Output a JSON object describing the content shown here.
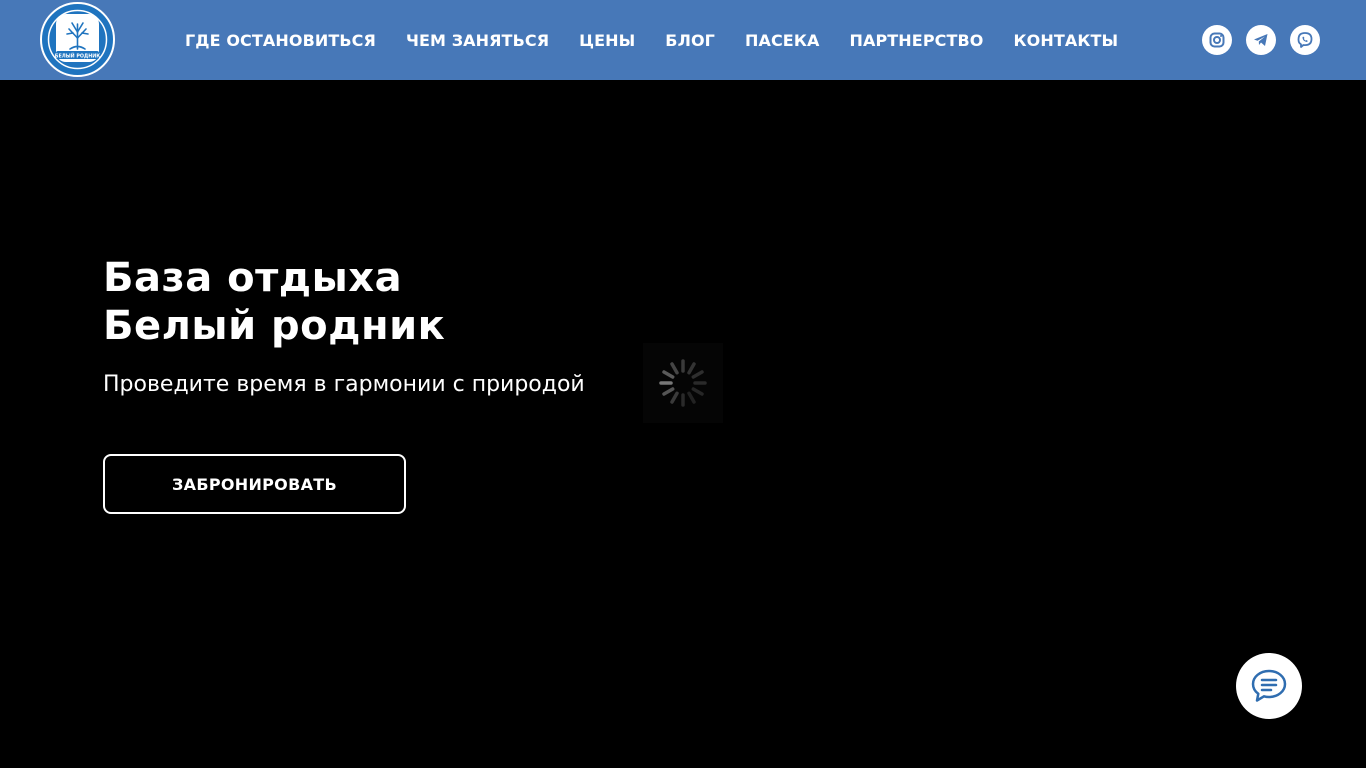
{
  "header": {
    "background_color": "#4778b8",
    "logo": {
      "icon": "beliy-rodnik-logo",
      "text": "БЕЛЫЙ РОДНИК"
    },
    "nav": [
      {
        "label": "ГДЕ ОСТАНОВИТЬСЯ"
      },
      {
        "label": "ЧЕМ ЗАНЯТЬСЯ"
      },
      {
        "label": "ЦЕНЫ"
      },
      {
        "label": "БЛОГ"
      },
      {
        "label": "ПАСЕКА"
      },
      {
        "label": "ПАРТНЕРСТВО"
      },
      {
        "label": "КОНТАКТЫ"
      }
    ],
    "socials": [
      {
        "icon": "instagram-icon"
      },
      {
        "icon": "telegram-icon"
      },
      {
        "icon": "viber-icon"
      }
    ]
  },
  "hero": {
    "title_line1": "База отдыха",
    "title_line2": "Белый родник",
    "subtitle": "Проведите время в гармонии с природой",
    "cta_label": "ЗАБРОНИРОВАТЬ"
  },
  "loader": {
    "icon": "loading-spinner-icon"
  },
  "chat": {
    "icon": "chat-bubble-icon",
    "accent_color": "#2f6db0"
  }
}
